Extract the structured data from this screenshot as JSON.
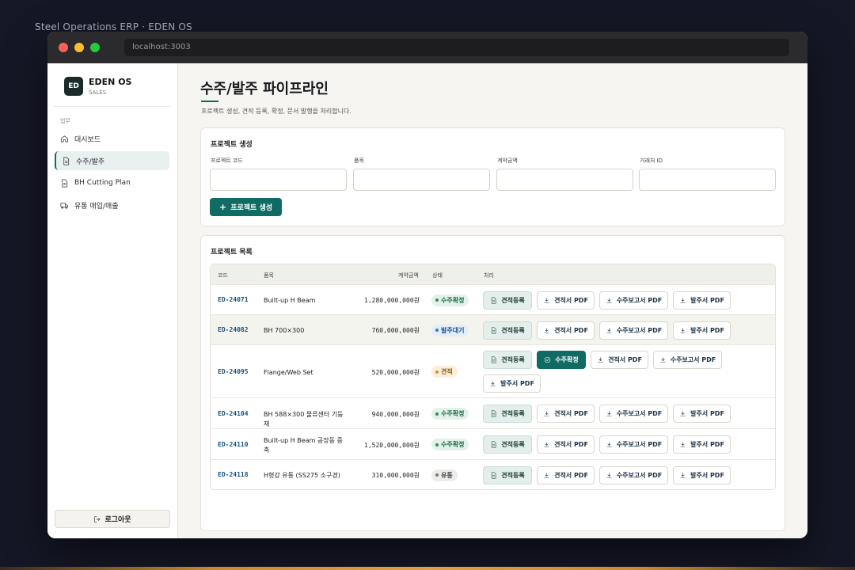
{
  "page_caption": "Steel Operations ERP · EDEN OS",
  "browser": {
    "url": "localhost:3003"
  },
  "sidebar": {
    "logo_text": "ED",
    "brand_name": "EDEN OS",
    "brand_sub": "SALES",
    "section_label": "업무",
    "items": [
      {
        "label": "대시보드",
        "icon": "home-icon"
      },
      {
        "label": "수주/발주",
        "icon": "document-icon",
        "active": true
      },
      {
        "label": "BH Cutting Plan",
        "icon": "document-icon"
      },
      {
        "label": "유통 매입/매출",
        "icon": "truck-icon"
      }
    ],
    "logout_label": "로그아웃"
  },
  "main": {
    "title": "수주/발주 파이프라인",
    "description": "프로젝트 생성, 견적 등록, 확정, 문서 발행을 처리합니다.",
    "create_card": {
      "title": "프로젝트 생성",
      "fields": [
        {
          "label": "프로젝트 코드",
          "value": ""
        },
        {
          "label": "품목",
          "value": ""
        },
        {
          "label": "계약금액",
          "value": ""
        },
        {
          "label": "거래처 ID",
          "value": ""
        }
      ],
      "submit_label": "프로젝트 생성"
    },
    "list_card": {
      "title": "프로젝트 목록",
      "columns": [
        "코드",
        "품목",
        "계약금액",
        "상태",
        "처리"
      ],
      "rows": [
        {
          "code": "ED-24071",
          "item": "Built-up H Beam",
          "amount": "1,280,000,000원",
          "status": "수주확정",
          "status_color": "green",
          "actions": [
            "견적등록",
            "견적서 PDF",
            "수주보고서 PDF",
            "발주서 PDF"
          ]
        },
        {
          "code": "ED-24082",
          "item": "BH 700×300",
          "amount": "760,000,000원",
          "status": "발주대기",
          "status_color": "blue",
          "actions": [
            "견적등록",
            "견적서 PDF",
            "수주보고서 PDF",
            "발주서 PDF"
          ]
        },
        {
          "code": "ED-24095",
          "item": "Flange/Web Set",
          "amount": "520,000,000원",
          "status": "견적",
          "status_color": "amber",
          "actions": [
            "견적등록",
            "수주확정",
            "견적서 PDF",
            "수주보고서 PDF",
            "발주서 PDF"
          ]
        },
        {
          "code": "ED-24104",
          "item": "BH 588×300 물류센터 기둥재",
          "amount": "940,000,000원",
          "status": "수주확정",
          "status_color": "green",
          "actions": [
            "견적등록",
            "견적서 PDF",
            "수주보고서 PDF",
            "발주서 PDF"
          ]
        },
        {
          "code": "ED-24110",
          "item": "Built-up H Beam 공장동 증축",
          "amount": "1,520,000,000원",
          "status": "수주확정",
          "status_color": "green",
          "actions": [
            "견적등록",
            "견적서 PDF",
            "수주보고서 PDF",
            "발주서 PDF"
          ]
        },
        {
          "code": "ED-24118",
          "item": "H형강 유통 (SS275 소구경)",
          "amount": "310,000,000원",
          "status": "유통",
          "status_color": "gray",
          "actions": [
            "견적등록",
            "견적서 PDF",
            "수주보고서 PDF",
            "발주서 PDF"
          ]
        }
      ]
    }
  },
  "colors": {
    "accent": "#0f6b63",
    "code_link": "#16537e",
    "background": "#151726"
  }
}
